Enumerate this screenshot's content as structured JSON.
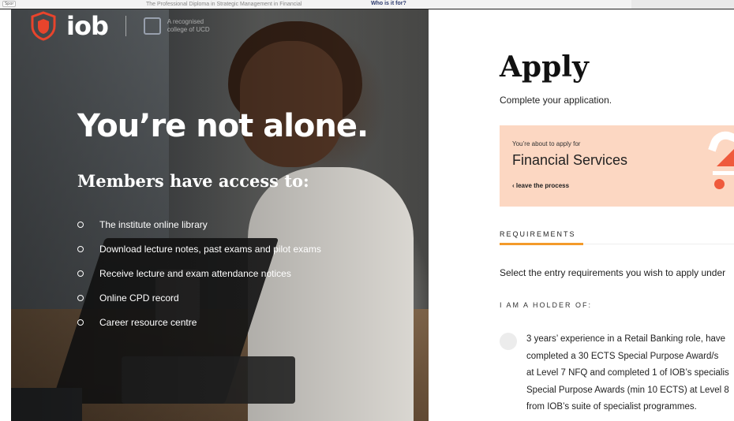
{
  "background_page": {
    "tag": "Spor",
    "text": "The Professional Diploma in Strategic Management in Financial",
    "link": "Who is it for?"
  },
  "brand": {
    "logo_text": "iob",
    "college_line1": "A recognised",
    "college_line2": "college of UCD",
    "shield_color": "#e8442c"
  },
  "hero": {
    "headline": "You’re not alone.",
    "subhead": "Members have access to:",
    "benefits": [
      "The institute online library",
      "Download lecture notes, past exams and pilot exams",
      "Receive lecture and exam attendance notices",
      "Online CPD record",
      "Career resource centre"
    ]
  },
  "apply": {
    "title": "Apply",
    "subtitle": "Complete your application.",
    "card": {
      "kicker": "You’re about to apply for",
      "programme": "Financial Services",
      "leave_link": "‹ leave the process",
      "bg_color": "#fcd7c2",
      "accent_color": "#ef5a3c"
    },
    "requirements_label": "REQUIREMENTS",
    "requirements_accent": "#f39a2a",
    "select_text": "Select the entry requirements you wish to apply under",
    "holder_label": "I AM A HOLDER OF:",
    "option_lines": [
      "3 years’ experience in a Retail Banking role, have",
      "completed a 30 ECTS Special Purpose Award/s",
      "at Level 7 NFQ and completed 1 of IOB’s specialis",
      "Special Purpose Awards (min 10 ECTS) at Level 8",
      "from IOB’s suite of specialist programmes."
    ]
  }
}
